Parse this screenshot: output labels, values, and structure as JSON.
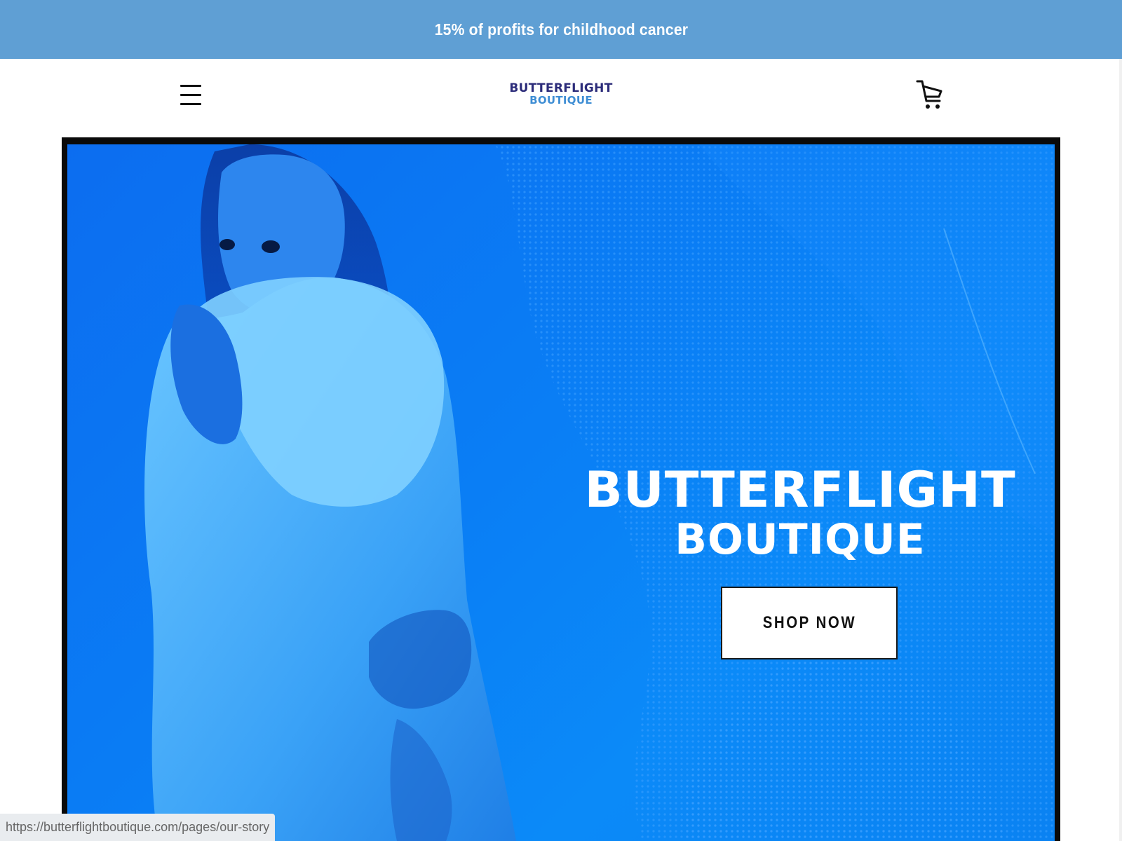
{
  "announcement": {
    "text": "15% of profits for childhood cancer",
    "background_color": "#5f9fd4"
  },
  "header": {
    "menu_icon": "hamburger-menu-icon",
    "logo": {
      "line1": "BUTTERFLIGHT",
      "line2": "BOUTIQUE"
    },
    "cart_icon": "shopping-cart-icon"
  },
  "hero": {
    "title_line1": "BUTTERFLIGHT",
    "title_line2": "BOUTIQUE",
    "cta_label": "SHOP NOW",
    "image_description_icon": "model-in-hoodie-photo",
    "accent_color": "#0a7ef5"
  },
  "status_bar": {
    "url": "https://butterflightboutique.com/pages/our-story"
  }
}
